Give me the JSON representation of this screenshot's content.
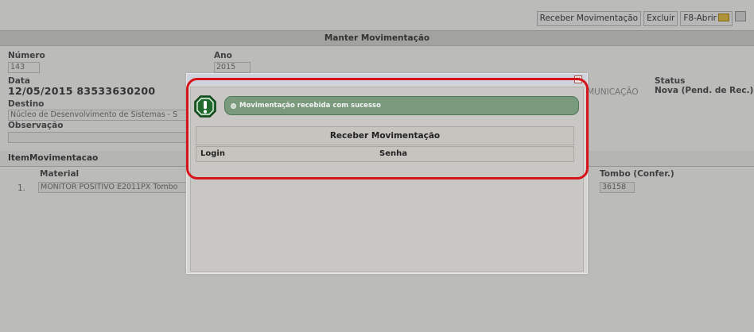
{
  "toolbar": {
    "receber_label": "Receber Movimentação",
    "excluir_label": "Excluir",
    "f8_label": "F8-Abrir"
  },
  "header": {
    "title": "Manter Movimentação"
  },
  "form": {
    "numero_label": "Número",
    "numero_value": "143",
    "ano_label": "Ano",
    "ano_value": "2015",
    "data_label": "Data",
    "data_value": "12/05/2015 83533630200",
    "destino_label": "Destino",
    "destino_value": "Núcleo de Desenvolvimento de Sistemas - S",
    "observacao_label": "Observação",
    "observacao_value": "",
    "tipo_partial": "MUNICAÇÃO",
    "status_label": "Status",
    "status_value": "Nova (Pend. de Rec.)"
  },
  "items": {
    "section_title": "ItemMovimentacao",
    "col_material": "Material",
    "col_tombo": "Tombo (Confer.)",
    "rows": [
      {
        "index": "1.",
        "material": "MONITOR POSITIVO E2011PX Tombo",
        "tombo": "36158"
      }
    ]
  },
  "modal": {
    "message": "Movimentação recebida com sucesso",
    "section_title": "Receber Movimentação",
    "login_label": "Login",
    "senha_label": "Senha",
    "close_icon": "close-icon",
    "warn_icon": "exclamation-octagon-icon"
  },
  "colors": {
    "highlight": "#d7131a",
    "message_bg": "#7a9a7d",
    "warn_icon": "#1f6a2c"
  }
}
